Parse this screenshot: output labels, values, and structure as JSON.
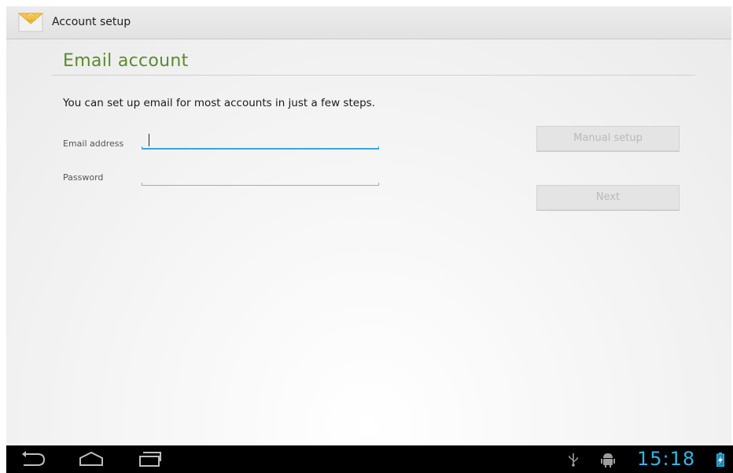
{
  "action_bar": {
    "title": "Account setup",
    "app_icon": "email-envelope-icon"
  },
  "content": {
    "heading": "Email account",
    "intro": "You can set up email for most accounts in just a few steps.",
    "email": {
      "label": "Email address",
      "value": "",
      "focused": true
    },
    "password": {
      "label": "Password",
      "value": ""
    },
    "buttons": {
      "manual_setup": "Manual setup",
      "next": "Next"
    }
  },
  "system_bar": {
    "clock": "15:18",
    "nav_icons": [
      "back-icon",
      "home-icon",
      "recents-icon"
    ],
    "status_icons": [
      "usb-icon",
      "android-debug-icon",
      "battery-icon"
    ]
  },
  "colors": {
    "heading": "#5d8a2f",
    "focus_accent": "#3aa6d6",
    "clock": "#33b5e5",
    "nav_bar": "#000000"
  }
}
